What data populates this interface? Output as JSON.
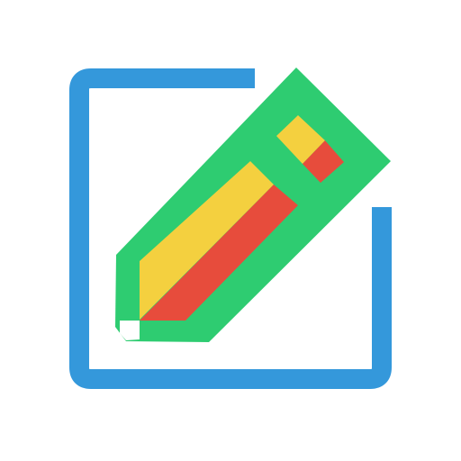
{
  "icon": {
    "name": "edit-icon",
    "colors": {
      "frame": "#3498db",
      "pencil_body": "#2ecc71",
      "stripe_yellow": "#f4d03f",
      "stripe_red": "#e74c3c",
      "tip": "#ffffff",
      "background": "#ffffff"
    }
  }
}
